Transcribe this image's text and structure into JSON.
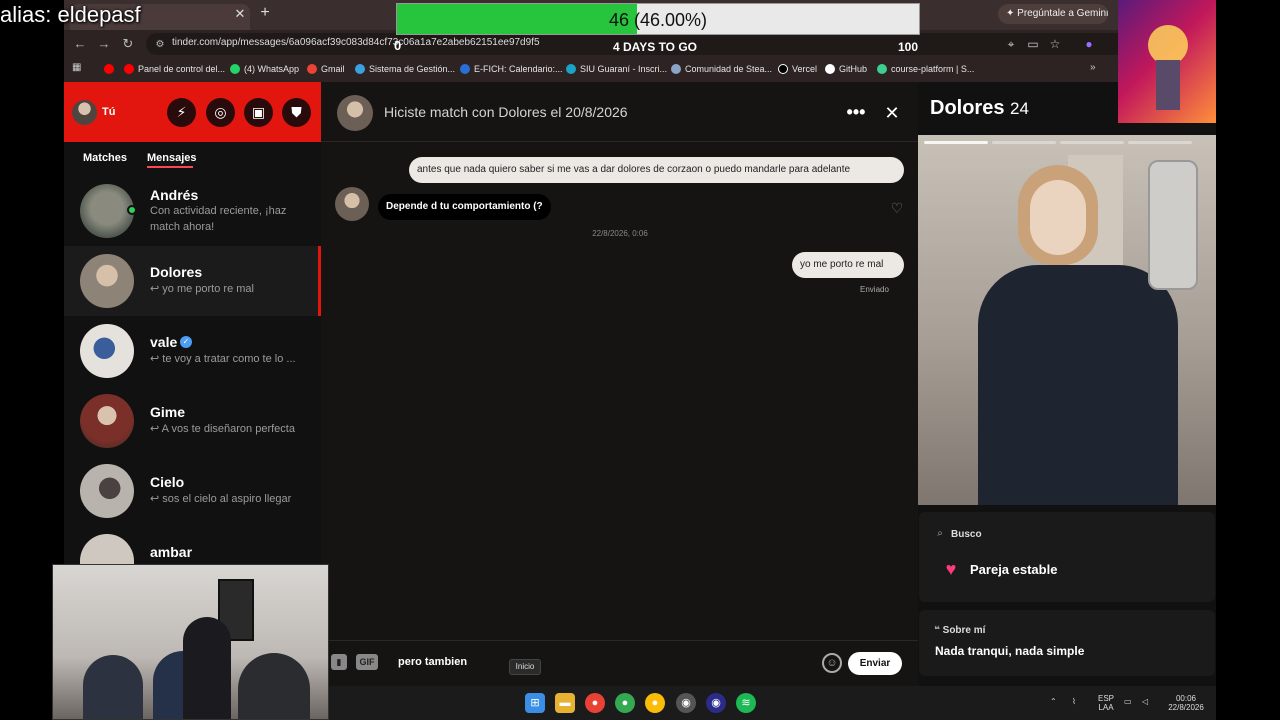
{
  "overlay": {
    "alias": "alias: eldepasf",
    "progress_label": "46 (46.00%)",
    "progress_fraction": 0.46,
    "start_value": "0",
    "countdown": "4 DAYS TO GO",
    "end_value": "100"
  },
  "browser": {
    "url": "tinder.com/app/messages/6a096acf39c083d84cf73c06a1a7e2abeb62151ee97d9f5",
    "gemini_button": "Pregúntale a Gemini",
    "bookmarks": [
      {
        "label": "Panel de control del...",
        "color": "#ff0000"
      },
      {
        "label": "(4) WhatsApp",
        "color": "#25d366"
      },
      {
        "label": "Gmail",
        "color": "#ea4335"
      },
      {
        "label": "Sistema de Gestión...",
        "color": "#3aa0e0"
      },
      {
        "label": "E-FICH: Calendario:...",
        "color": "#2a6fd6"
      },
      {
        "label": "SIU Guaraní - Inscri...",
        "color": "#1aa3c7"
      },
      {
        "label": "Comunidad de Stea...",
        "color": "#1b2838"
      },
      {
        "label": "Vercel",
        "color": "#000000"
      },
      {
        "label": "GitHub",
        "color": "#ffffff"
      },
      {
        "label": "course-platform | S...",
        "color": "#3ecf8e"
      }
    ]
  },
  "sidebar": {
    "me_label": "Tú",
    "tabs": [
      {
        "label": "Matches"
      },
      {
        "label": "Mensajes"
      }
    ],
    "conversations": [
      {
        "name": "Andrés",
        "preview": "Con actividad reciente, ¡haz",
        "preview2": "match ahora!",
        "online": true
      },
      {
        "name": "Dolores",
        "preview": "↩ yo me porto re mal",
        "active": true
      },
      {
        "name": "vale",
        "preview": "↩ te voy a tratar como te lo ...",
        "verified": true
      },
      {
        "name": "Gime",
        "preview": "↩ A vos te diseñaron perfecta"
      },
      {
        "name": "Cielo",
        "preview": "↩ sos el cielo al aspiro llegar"
      },
      {
        "name": "ambar",
        "preview": ""
      }
    ]
  },
  "chat": {
    "title": "Hiciste match con Dolores el 20/8/2026",
    "messages": [
      {
        "from": "me",
        "text": "antes que nada quiero saber si me vas a dar dolores de corzaon o puedo mandarle para adelante"
      },
      {
        "from": "them",
        "text": "Depende d tu comportamiento (?"
      },
      {
        "from": "me",
        "text": "yo me porto re mal"
      }
    ],
    "timestamp": "22/8/2026, 0:06",
    "sent_status": "Enviado",
    "composer_value": "pero tambien",
    "gif_label": "GIF",
    "send_label": "Enviar"
  },
  "profile": {
    "name": "Dolores",
    "age": "24",
    "looking_for_label": "Busco",
    "looking_for_value": "Pareja estable",
    "about_label": "Sobre mí",
    "about_value": "Nada tranqui, nada simple"
  },
  "taskbar": {
    "tooltip": "Inicio",
    "lang_top": "ESP",
    "lang_bottom": "LAA",
    "time": "00:06",
    "date": "22/8/2026"
  }
}
